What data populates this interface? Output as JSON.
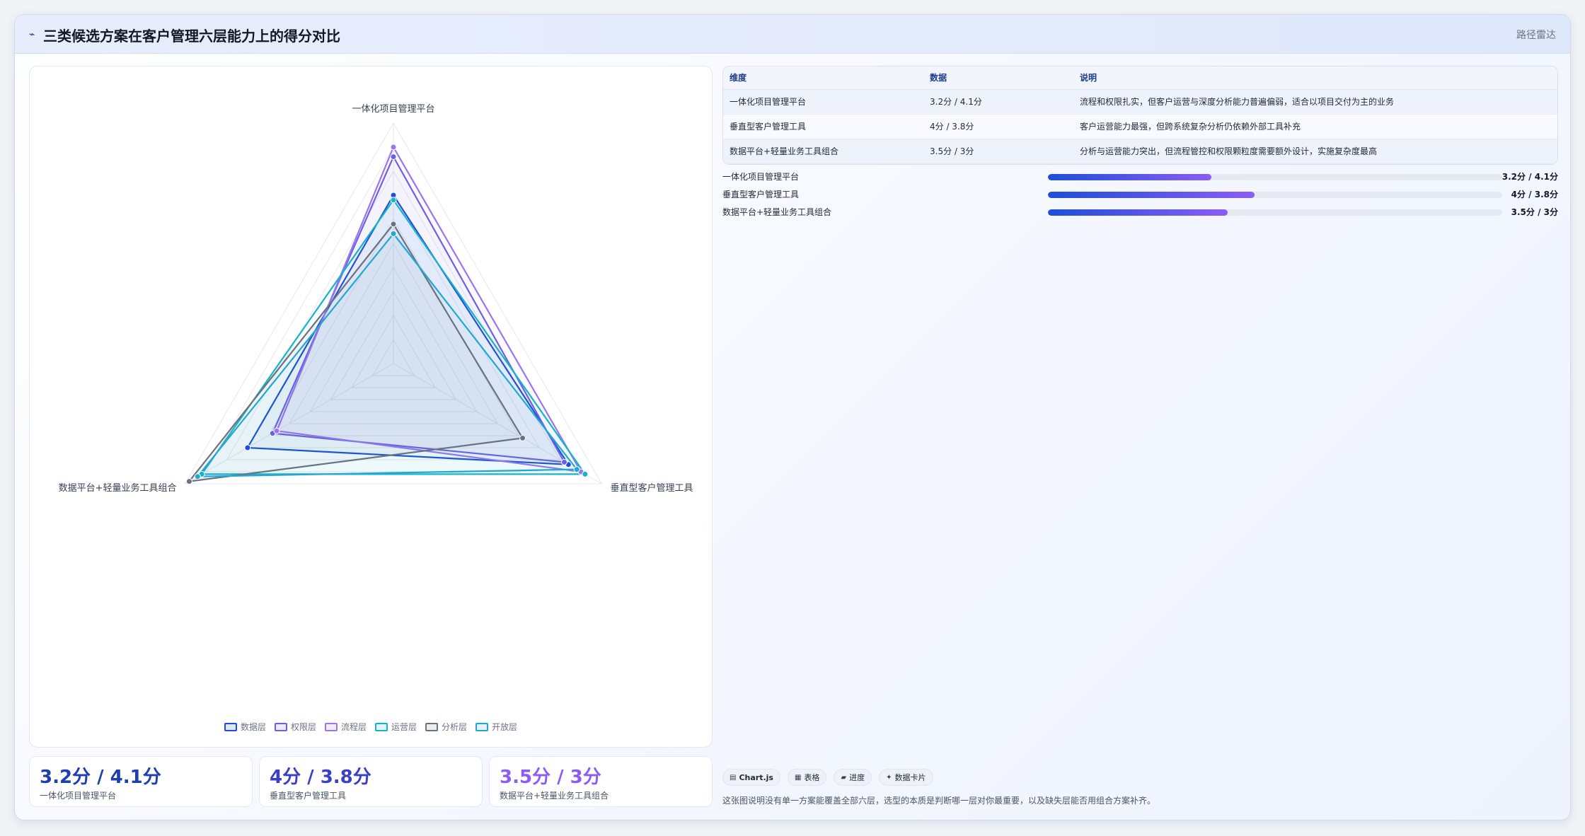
{
  "header": {
    "title": "三类候选方案在客户管理六层能力上的得分对比",
    "icon": "trend-line-icon",
    "right_label": "路径雷达"
  },
  "chart_data": {
    "type": "radar",
    "title": "",
    "axes": [
      "一体化项目管理平台",
      "垂直型客户管理工具",
      "数据平台+轻量业务工具组合"
    ],
    "rlim": [
      0,
      5
    ],
    "grid": true,
    "legend_position": "bottom",
    "series": [
      {
        "name": "数据层",
        "color": "#1d4ed8",
        "values": [
          3.5,
          4.2,
          3.5
        ]
      },
      {
        "name": "权限层",
        "color": "#6d5ee8",
        "values": [
          4.3,
          4.1,
          2.9
        ]
      },
      {
        "name": "流程层",
        "color": "#9b74ee",
        "values": [
          4.5,
          4.5,
          2.8
        ]
      },
      {
        "name": "运营层",
        "color": "#17b3c8",
        "values": [
          3.4,
          4.6,
          4.6
        ]
      },
      {
        "name": "分析层",
        "color": "#6b7280",
        "values": [
          2.9,
          3.1,
          4.9
        ]
      },
      {
        "name": "开放层",
        "color": "#22a7d4",
        "values": [
          2.7,
          4.4,
          4.7
        ]
      }
    ]
  },
  "stats": [
    {
      "value": "3.2分 / 4.1分",
      "label": "一体化项目管理平台",
      "color": "#1e40af"
    },
    {
      "value": "4分 / 3.8分",
      "label": "垂直型客户管理工具",
      "color": "#3b3fc7"
    },
    {
      "value": "3.5分 / 3分",
      "label": "数据平台+轻量业务工具组合",
      "color": "#8b5cf6"
    }
  ],
  "table": {
    "headers": [
      "维度",
      "数据",
      "说明"
    ],
    "rows": [
      [
        "一体化项目管理平台",
        "3.2分 / 4.1分",
        "流程和权限扎实，但客户运营与深度分析能力普遍偏弱，适合以项目交付为主的业务"
      ],
      [
        "垂直型客户管理工具",
        "4分 / 3.8分",
        "客户运营能力最强，但跨系统复杂分析仍依赖外部工具补充"
      ],
      [
        "数据平台+轻量业务工具组合",
        "3.5分 / 3分",
        "分析与运营能力突出，但流程管控和权限颗粒度需要额外设计，实施复杂度最高"
      ]
    ]
  },
  "progress": [
    {
      "label": "一体化项目管理平台",
      "value": "3.2分 / 4.1分",
      "fraction": 0.36
    },
    {
      "label": "垂直型客户管理工具",
      "value": "4分 / 3.8分",
      "fraction": 0.455
    },
    {
      "label": "数据平台+轻量业务工具组合",
      "value": "3.5分 / 3分",
      "fraction": 0.395
    }
  ],
  "chips": [
    {
      "icon": "grid-icon",
      "label": "Chart.js"
    },
    {
      "icon": "table-icon",
      "label": "表格"
    },
    {
      "icon": "progress-icon",
      "label": "进度"
    },
    {
      "icon": "sparkle-icon",
      "label": "数据卡片"
    }
  ],
  "footnote": "这张图说明没有单一方案能覆盖全部六层，选型的本质是判断哪一层对你最重要，以及缺失层能否用组合方案补齐。"
}
